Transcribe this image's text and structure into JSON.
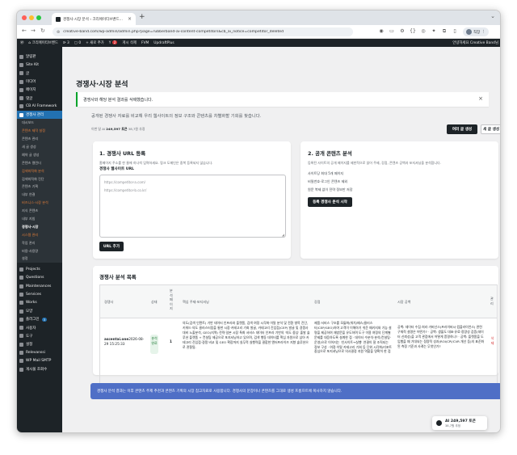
{
  "browser": {
    "tab_title": "경쟁사·시장 분석 ‹ 크리에이티브밴드...",
    "url": "creative-band.com/wp-admin/admin.php?page=rubberband-ai-content-competitors&cb_ai_notice=competitor_deleted",
    "profile_label": "직장"
  },
  "adminbar": {
    "site": "크리에이티브밴드",
    "updates": "3",
    "comments": "0",
    "new_label": "+ 새로 추가",
    "yoast_count": "2",
    "post_view": "게시 삭제",
    "fvm": "FVM",
    "updraft": "UpdraftPlus",
    "greeting": "안녕하세요 Creative Band님"
  },
  "sidebar": {
    "items": [
      {
        "label": "알림판"
      },
      {
        "label": "Site Kit"
      },
      {
        "label": "글"
      },
      {
        "label": "미디어"
      },
      {
        "label": "페이지"
      },
      {
        "label": "댓글"
      },
      {
        "label": "CB AI Framework"
      },
      {
        "label": "경쟁사 관리"
      }
    ],
    "subitems": [
      {
        "label": "대시보드",
        "type": "normal"
      },
      {
        "label": "콘텐츠 제작 설정",
        "type": "section"
      },
      {
        "label": "콘텐츠 관리",
        "type": "normal"
      },
      {
        "label": "새 글 생성",
        "type": "normal"
      },
      {
        "label": "예약 글 생성",
        "type": "normal"
      },
      {
        "label": "콘텐츠 캘린더",
        "type": "normal"
      },
      {
        "label": "검색최적화 분석",
        "type": "section"
      },
      {
        "label": "검색최적화 진단",
        "type": "normal"
      },
      {
        "label": "콘텐츠 기획",
        "type": "normal"
      },
      {
        "label": "내부 연결",
        "type": "normal"
      },
      {
        "label": "비즈니스·시장 분석",
        "type": "section"
      },
      {
        "label": "지식 콘텐츠",
        "type": "normal"
      },
      {
        "label": "내부 지침",
        "type": "normal"
      },
      {
        "label": "경쟁사·시장",
        "type": "bold"
      },
      {
        "label": "시스템 관리",
        "type": "section"
      },
      {
        "label": "작업 관리",
        "type": "normal"
      },
      {
        "label": "비용·사용량",
        "type": "normal"
      },
      {
        "label": "설정",
        "type": "normal"
      }
    ],
    "items2": [
      {
        "label": "Projects"
      },
      {
        "label": "Questions"
      },
      {
        "label": "Maintenances"
      },
      {
        "label": "Services"
      },
      {
        "label": "Works"
      },
      {
        "label": "모양"
      },
      {
        "label": "플러그인",
        "badge": "3"
      },
      {
        "label": "사용자"
      },
      {
        "label": "도구"
      },
      {
        "label": "설정"
      },
      {
        "label": "Relevanssi"
      },
      {
        "label": "WP Mail SMTP"
      },
      {
        "label": "게시물 조회수"
      }
    ]
  },
  "page": {
    "title": "경쟁사·시장 분석",
    "notice": "경쟁사와 해당 분석 결과를 삭제했습니다.",
    "description": "공개된 경쟁사 자료를 비교해 우리 웹사이트의 정보 구조와 콘텐츠를 차별화할 기회를 찾습니다.",
    "usage_prefix": "이번 달 AI",
    "usage_tokens": "249,597 토큰",
    "usage_suffix": "38,7원 추정",
    "btn_multi": "여러 글 생성",
    "btn_new": "새 글 생성"
  },
  "card1": {
    "title": "1. 경쟁사 URL 등록",
    "help": "홈페이지 주소를 한 줄에 하나씩 입력하세요. 핑크 도메인은 중복 등록되지 않습니다.",
    "field_label": "경쟁사 웹사이트 URL",
    "placeholder_1": "https://competitor-a.com/",
    "placeholder_2": "https://competitor-b.co.kr/",
    "button": "URL 추가"
  },
  "card2": {
    "title": "2. 공개 콘텐츠 분석",
    "help": "등록된 사이트의 공개 페이지를 제한적으로 읽어 주제, 강점, 콘텐츠 공백과 포지셔닝을 분석합니다.",
    "lines": [
      "사이트당 최대 5개 페이지",
      "비밀번호·로그인 콘텐츠 제외",
      "원문 복제 없이 전략 정보만 저장"
    ],
    "button": "등록 경쟁사 분석 시작"
  },
  "table": {
    "title": "경쟁사 분석 목록",
    "headers": {
      "competitor": "경쟁사",
      "status": "상태",
      "pages": "분석 페이지",
      "summary": "핵심 주제·포지셔닝",
      "strengths": "강점",
      "gaps": "시장 공백",
      "manage": "관리"
    },
    "row": {
      "competitor": "ascentai.one",
      "date": "2026-08-29 15:25:33",
      "status": "분석 완료",
      "pages": "1",
      "summary": "의도(검색 인텐트) 기반 데이터 인프라와 플랫폼, 검색 여정 시각화·이탈 분석 및 전환 병목 진단, 키워드·의도 클러스터링을 통한 시장·카테고리 기회 발굴, 카테고리 진입점(CEP) 발굴 및 경쟁사 대비 노출분석, GEO(지역) 전략·일본 시장 특화 서비스 데이터 인프라 기반의 '의도 중심' 출발 솔루션 플랫폼 + 컨설팅 제공으로 포지셔닝하고 있으며, 검색 행동 데이터를 핵심 자원으로 삼아 카테고리 진입점·경쟁 비교 및 GEO 확장까지 실무적 실행력을 결합한 엔터프라이즈 지향 솔루션으로 관찰됨.",
      "strengths": "제품·서비스 구조를 모듈화(워치/패스/클러스터/CEP/GEO)하여 고객이 이해하기 쉬운 패키지와 기능 설명을 제공하여 재방문을 유도하며 도구 이용 여정의 단계별 문제를 대응하도록 설계한 점 · 데이터 수분석·분석(컨설팅·운영)으로 이어지는 '인사이트→실행' 연결이 잘 조직되는 정보 구성 · 여정·이탈 카테고리 기회 등 단위 시각화/리포트 중심으로 포지셔닝으로 의사결정 지원 역할을 명확히 한 점",
      "gaps": "공백: 데이터 수집·처리·거버넌스(프라이버시·컴플라이언스) 관련 구체적 설명은 어떤가? · 공백: 생물도 대표·유료·정량성 검증(데이터 신뢰성)을 고객 관점에서 어떻게 증명하나? · 공백: 플랫폼을 도입했을 때 기대되는 정량적 성과(ROI/CPI/CVR 개선 등)의 표준화된 측정 기준과 사례는 무엇인가?",
      "delete": "삭제"
    }
  },
  "info_bar": "경쟁사 분석 결과는 이후 콘텐츠 주제 추천과 콘텐츠 기획의 시장 참고자료로 사용합니다. 경쟁사의 문장이나 콘텐츠를 그대로 생성 프롬프트에 복사하지 않습니다.",
  "toast": {
    "tokens": "AI 249,597 토큰",
    "cost": "38,7원 추정"
  },
  "colors": {
    "wp_dark": "#1d2327",
    "wp_blue": "#2271b1",
    "success": "#00a32a",
    "info_bar": "#4f6fc6"
  }
}
